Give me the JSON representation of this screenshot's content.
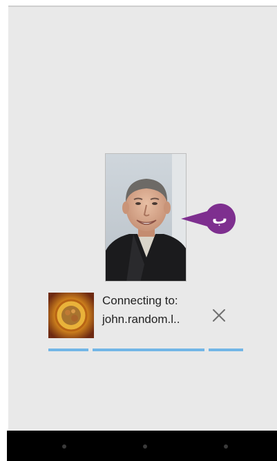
{
  "call": {
    "status_label": "Connecting to:",
    "address": "john.random.l..",
    "close_icon": "close-icon"
  },
  "callout": {
    "label": "ب",
    "color": "#7e2f8f"
  },
  "colors": {
    "progress": "#72b6e6",
    "screen_background": "#e9e9e9",
    "navbar": "#000000"
  },
  "navigation": {
    "items": [
      "back-button",
      "home-button",
      "recents-button"
    ]
  }
}
